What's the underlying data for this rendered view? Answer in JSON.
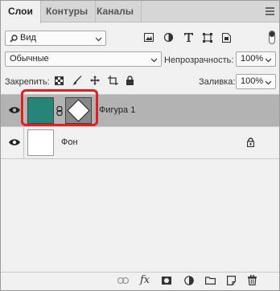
{
  "tabs": [
    {
      "label": "Слои",
      "active": true
    },
    {
      "label": "Контуры",
      "active": false
    },
    {
      "label": "Каналы",
      "active": false
    }
  ],
  "filter": {
    "value": "Вид",
    "icons": [
      "image-filter-icon",
      "adjustment-filter-icon",
      "type-filter-icon",
      "shape-filter-icon",
      "smart-object-filter-icon"
    ]
  },
  "blend": {
    "mode": "Обычные",
    "opacity_label": "Непрозрачность:",
    "opacity_value": "100%"
  },
  "lock": {
    "label": "Закрепить:",
    "fill_label": "Заливка:",
    "fill_value": "100%"
  },
  "layers": [
    {
      "name": "Фигура 1",
      "selected": true,
      "thumb_color": "#268577",
      "locked": false
    },
    {
      "name": "Фон",
      "selected": false,
      "thumb_color": "#ffffff",
      "locked": true
    }
  ],
  "bottom_icons": [
    "link-icon",
    "fx-icon",
    "mask-icon",
    "adjustment-icon",
    "group-icon",
    "new-layer-icon",
    "trash-icon"
  ],
  "fx_label": "fx",
  "accent": "#e02020"
}
